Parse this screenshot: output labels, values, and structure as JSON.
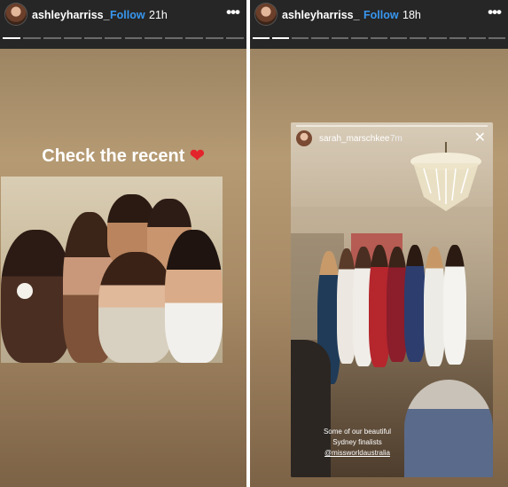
{
  "left_story": {
    "username": "ashleyharriss_",
    "follow_label": "Follow",
    "time": "21h",
    "more_label": "•••",
    "caption": "Check the recent",
    "heart": "❤",
    "progress_segments": [
      1,
      0,
      0,
      0,
      0,
      0,
      0,
      0,
      0,
      0,
      0,
      0
    ]
  },
  "right_story": {
    "username": "ashleyharriss_",
    "follow_label": "Follow",
    "time": "18h",
    "more_label": "•••",
    "progress_segments": [
      1,
      1,
      0,
      0,
      0,
      0,
      0,
      0,
      0,
      0,
      0,
      0,
      0
    ],
    "embedded_story": {
      "username": "sarah_marschkee",
      "time": "7m",
      "close_label": "✕",
      "caption_line1": "Some of our beautiful",
      "caption_line2": "Sydney finalists",
      "mention": "@missworldaustralia"
    }
  },
  "colors": {
    "panel_bg": "#262626",
    "follow": "#3897f0",
    "heart": "#e3242b"
  }
}
